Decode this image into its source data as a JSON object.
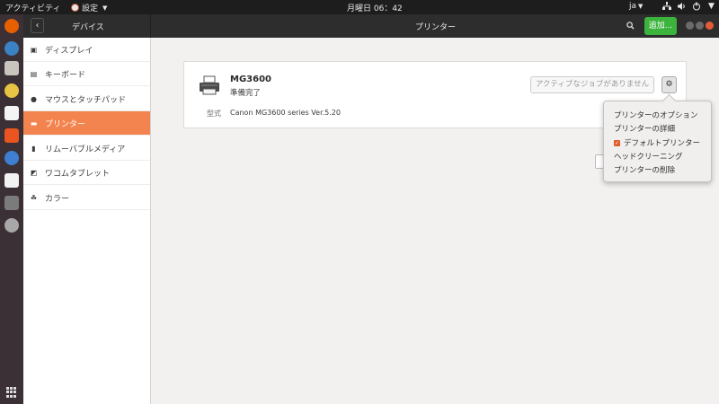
{
  "topbar": {
    "activities": "アクティビティ",
    "app_name": "設定",
    "clock": "月曜日 06：42",
    "language": "ja"
  },
  "header": {
    "left_title": "デバイス",
    "center_title": "プリンター",
    "add_label": "追加..."
  },
  "sidebar": {
    "items": [
      {
        "label": "ディスプレイ",
        "icon": "display-icon"
      },
      {
        "label": "キーボード",
        "icon": "keyboard-icon"
      },
      {
        "label": "マウスとタッチパッド",
        "icon": "mouse-icon"
      },
      {
        "label": "プリンター",
        "icon": "printer-icon"
      },
      {
        "label": "リムーバブルメディア",
        "icon": "usb-icon"
      },
      {
        "label": "ワコムタブレット",
        "icon": "tablet-icon"
      },
      {
        "label": "カラー",
        "icon": "color-icon"
      }
    ],
    "active_index": 3
  },
  "printer": {
    "name": "MG3600",
    "status": "準備完了",
    "model_label": "型式",
    "model_value": "Canon MG3600 series Ver.5.20",
    "jobs_button": "アクティブなジョブがありません"
  },
  "menu": {
    "options": "プリンターのオプション",
    "details": "プリンターの詳細",
    "default": "デフォルトプリンター",
    "default_checked": true,
    "clean": "ヘッドクリーニング",
    "remove": "プリンターの削除"
  },
  "colors": {
    "accent": "#f4844f",
    "add_button": "#3cb33c",
    "close_button": "#e35c39"
  }
}
